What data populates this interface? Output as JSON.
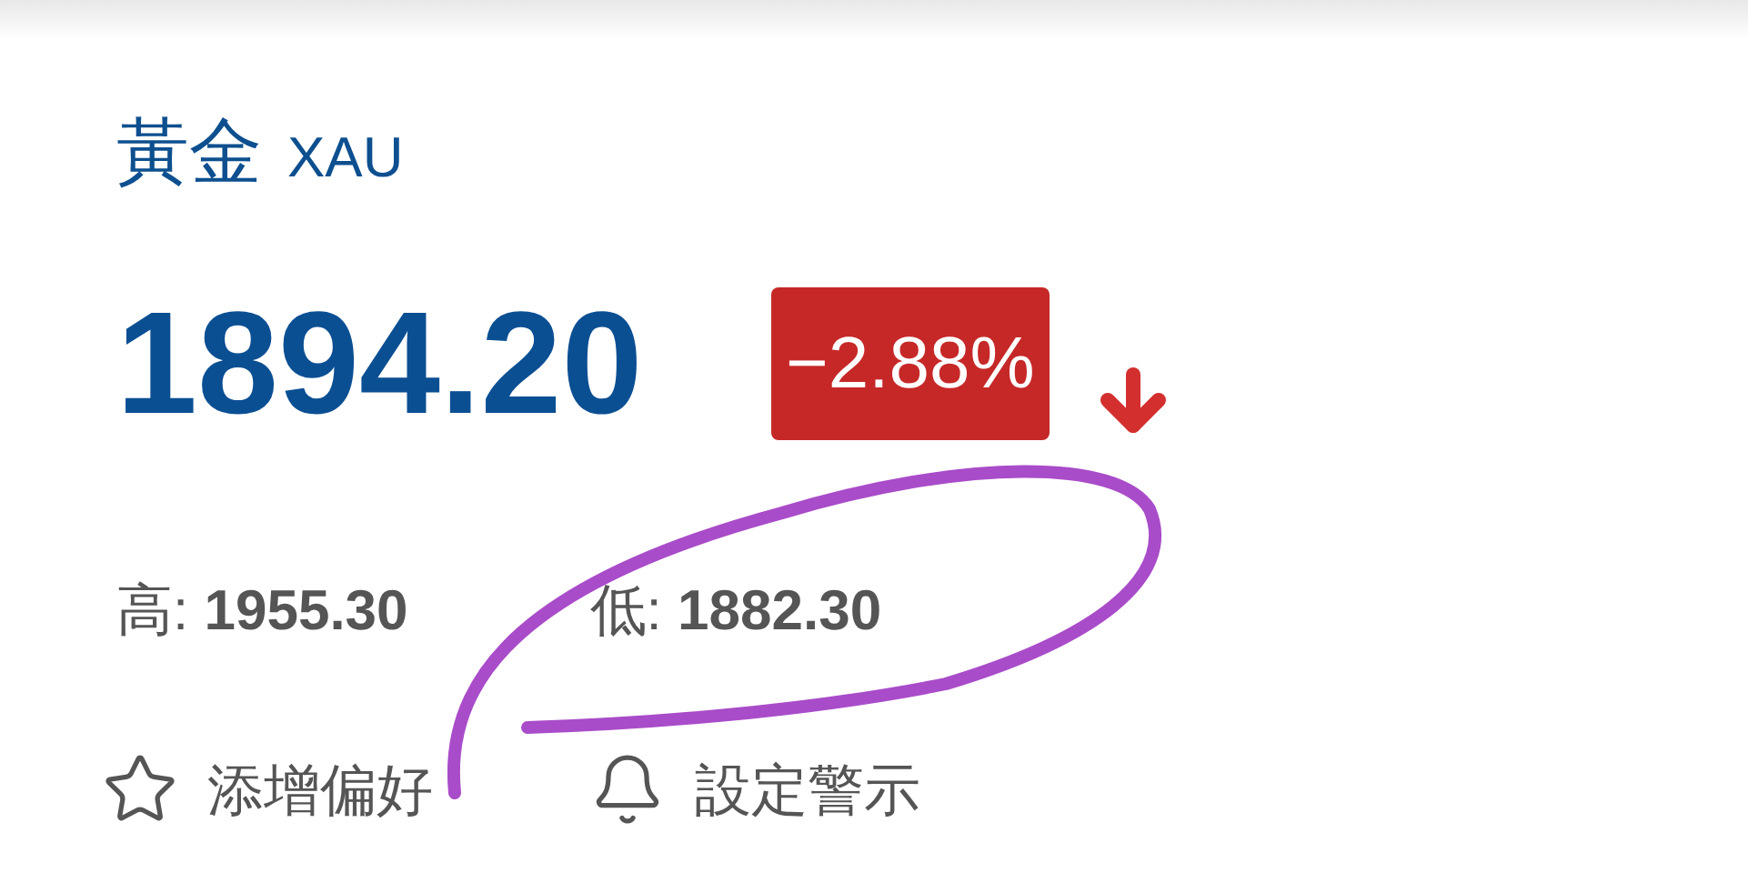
{
  "title": {
    "name": "黃金",
    "code": "XAU"
  },
  "price": "1894.20",
  "change": {
    "text": "−2.88%",
    "falling": true
  },
  "stats": [
    {
      "text": "高: **1955.30**"
    },
    {
      "text": "低: **1882.30**"
    }
  ],
  "actions": [
    {
      "kind": "favorite",
      "label": "添增偏好"
    },
    {
      "kind": "alert",
      "label": "設定警示"
    }
  ]
}
